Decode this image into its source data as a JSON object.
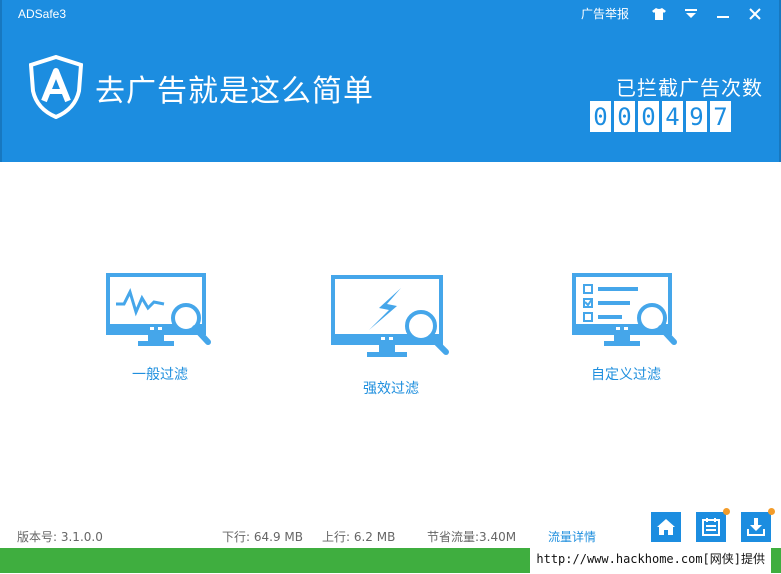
{
  "app": {
    "title": "ADSafe3",
    "report_link": "广告举报",
    "slogan": "去广告就是这么简单",
    "blocked_label": "已拦截广告次数",
    "blocked_count_digits": [
      "0",
      "0",
      "0",
      "4",
      "9",
      "7"
    ]
  },
  "features": [
    {
      "label": "一般过滤",
      "icon": "monitor-waveform-search-icon"
    },
    {
      "label": "强效过滤",
      "icon": "monitor-lightning-search-icon"
    },
    {
      "label": "自定义过滤",
      "icon": "monitor-checklist-search-icon"
    }
  ],
  "footer": {
    "version": "版本号:  3.1.0.0",
    "download": "下行: 64.9 MB",
    "upload": "上行: 6.2 MB",
    "saved": "节省流量:3.40M",
    "detail_link": "流量详情"
  },
  "watermark": "http://www.hackhome.com[网侠]提供",
  "colors": {
    "header_bg": "#1c8de0",
    "accent": "#1f8fde",
    "badge": "#f39c2a",
    "bottom_bar": "#3fae3f"
  }
}
